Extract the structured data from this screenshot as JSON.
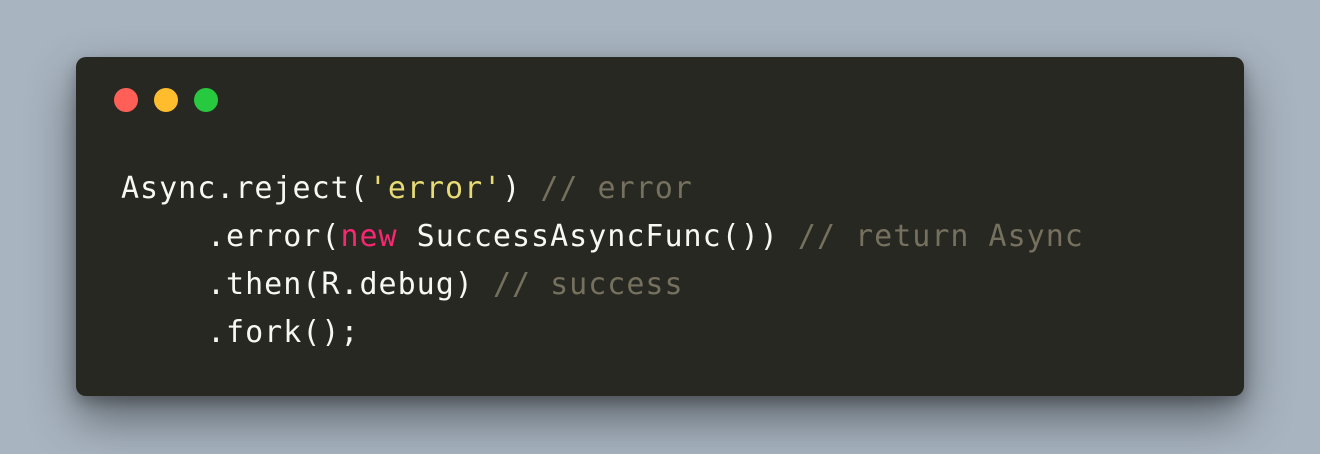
{
  "window_controls": {
    "close_color": "#ff5f56",
    "minimize_color": "#ffbd2e",
    "maximize_color": "#27c93f"
  },
  "colors": {
    "background": "#a8b4c0",
    "editor_background": "#272822",
    "default_text": "#f8f8f2",
    "string": "#e6db74",
    "keyword": "#f92672",
    "comment": "#75715e"
  },
  "code": {
    "line1": {
      "call": "Async.reject(",
      "string": "'error'",
      "close": ") ",
      "comment": "// error"
    },
    "line2": {
      "call": ".error(",
      "keyword": "new",
      "rest": " SuccessAsyncFunc()) ",
      "comment": "// return Async"
    },
    "line3": {
      "call": ".then(R.debug) ",
      "comment": "// success"
    },
    "line4": {
      "call": ".fork();"
    }
  }
}
